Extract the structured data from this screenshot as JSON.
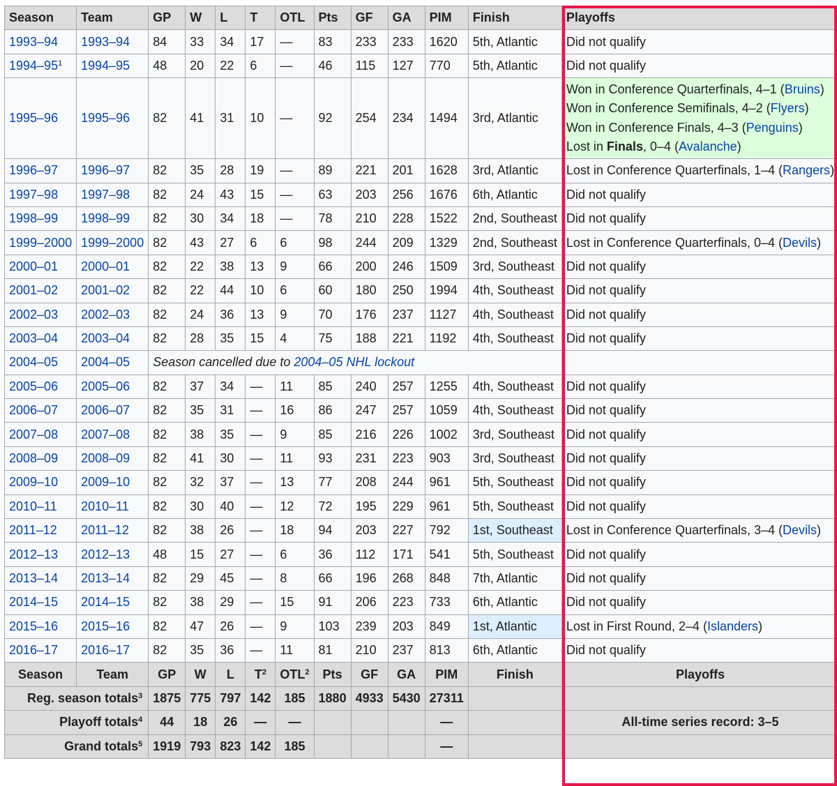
{
  "headers": [
    "Season",
    "Team",
    "GP",
    "W",
    "L",
    "T",
    "OTL",
    "Pts",
    "GF",
    "GA",
    "PIM",
    "Finish",
    "Playoffs"
  ],
  "rows": [
    {
      "season": "1993–94",
      "team": "1993–94",
      "gp": "84",
      "w": "33",
      "l": "34",
      "t": "17",
      "otl": "—",
      "pts": "83",
      "gf": "233",
      "ga": "233",
      "pim": "1620",
      "finish": "5th, Atlantic",
      "playoffs": "Did not qualify"
    },
    {
      "season": "1994–95",
      "season_sup": "1",
      "team": "1994–95",
      "gp": "48",
      "w": "20",
      "l": "22",
      "t": "6",
      "otl": "—",
      "pts": "46",
      "gf": "115",
      "ga": "127",
      "pim": "770",
      "finish": "5th, Atlantic",
      "playoffs": "Did not qualify"
    },
    {
      "season": "1995–96",
      "team": "1995–96",
      "gp": "82",
      "w": "41",
      "l": "31",
      "t": "10",
      "otl": "—",
      "pts": "92",
      "gf": "254",
      "ga": "234",
      "pim": "1494",
      "finish": "3rd, Atlantic",
      "playoff_lines": [
        {
          "pre": "Won in Conference Quarterfinals, 4–1 (",
          "bold": "",
          "link": "Bruins",
          "post": ")"
        },
        {
          "pre": "Won in Conference Semifinals, 4–2 (",
          "bold": "",
          "link": "Flyers",
          "post": ")"
        },
        {
          "pre": "Won in Conference Finals, 4–3 (",
          "bold": "",
          "link": "Penguins",
          "post": ")"
        },
        {
          "pre": "Lost in ",
          "bold": "Finals",
          "mid": ", 0–4 (",
          "link": "Avalanche",
          "post": ")"
        }
      ]
    },
    {
      "season": "1996–97",
      "team": "1996–97",
      "gp": "82",
      "w": "35",
      "l": "28",
      "t": "19",
      "otl": "—",
      "pts": "89",
      "gf": "221",
      "ga": "201",
      "pim": "1628",
      "finish": "3rd, Atlantic",
      "playoff_pre": "Lost in Conference Quarterfinals, 1–4 (",
      "playoff_link": "Rangers",
      "playoff_post": ")"
    },
    {
      "season": "1997–98",
      "team": "1997–98",
      "gp": "82",
      "w": "24",
      "l": "43",
      "t": "15",
      "otl": "—",
      "pts": "63",
      "gf": "203",
      "ga": "256",
      "pim": "1676",
      "finish": "6th, Atlantic",
      "playoffs": "Did not qualify"
    },
    {
      "season": "1998–99",
      "team": "1998–99",
      "gp": "82",
      "w": "30",
      "l": "34",
      "t": "18",
      "otl": "—",
      "pts": "78",
      "gf": "210",
      "ga": "228",
      "pim": "1522",
      "finish": "2nd, Southeast",
      "playoffs": "Did not qualify"
    },
    {
      "season": "1999–2000",
      "team": "1999–2000",
      "gp": "82",
      "w": "43",
      "l": "27",
      "t": "6",
      "otl": "6",
      "pts": "98",
      "gf": "244",
      "ga": "209",
      "pim": "1329",
      "finish": "2nd, Southeast",
      "playoff_pre": "Lost in Conference Quarterfinals, 0–4 (",
      "playoff_link": "Devils",
      "playoff_post": ")"
    },
    {
      "season": "2000–01",
      "team": "2000–01",
      "gp": "82",
      "w": "22",
      "l": "38",
      "t": "13",
      "otl": "9",
      "pts": "66",
      "gf": "200",
      "ga": "246",
      "pim": "1509",
      "finish": "3rd, Southeast",
      "playoffs": "Did not qualify"
    },
    {
      "season": "2001–02",
      "team": "2001–02",
      "gp": "82",
      "w": "22",
      "l": "44",
      "t": "10",
      "otl": "6",
      "pts": "60",
      "gf": "180",
      "ga": "250",
      "pim": "1994",
      "finish": "4th, Southeast",
      "playoffs": "Did not qualify"
    },
    {
      "season": "2002–03",
      "team": "2002–03",
      "gp": "82",
      "w": "24",
      "l": "36",
      "t": "13",
      "otl": "9",
      "pts": "70",
      "gf": "176",
      "ga": "237",
      "pim": "1127",
      "finish": "4th, Southeast",
      "playoffs": "Did not qualify"
    },
    {
      "season": "2003–04",
      "team": "2003–04",
      "gp": "82",
      "w": "28",
      "l": "35",
      "t": "15",
      "otl": "4",
      "pts": "75",
      "gf": "188",
      "ga": "221",
      "pim": "1192",
      "finish": "4th, Southeast",
      "playoffs": "Did not qualify"
    },
    {
      "season": "2004–05",
      "team": "2004–05",
      "cancelled_pre": "Season cancelled due to ",
      "cancelled_link": "2004–05 NHL lockout"
    },
    {
      "season": "2005–06",
      "team": "2005–06",
      "gp": "82",
      "w": "37",
      "l": "34",
      "t": "—",
      "otl": "11",
      "pts": "85",
      "gf": "240",
      "ga": "257",
      "pim": "1255",
      "finish": "4th, Southeast",
      "playoffs": "Did not qualify"
    },
    {
      "season": "2006–07",
      "team": "2006–07",
      "gp": "82",
      "w": "35",
      "l": "31",
      "t": "—",
      "otl": "16",
      "pts": "86",
      "gf": "247",
      "ga": "257",
      "pim": "1059",
      "finish": "4th, Southeast",
      "playoffs": "Did not qualify"
    },
    {
      "season": "2007–08",
      "team": "2007–08",
      "gp": "82",
      "w": "38",
      "l": "35",
      "t": "—",
      "otl": "9",
      "pts": "85",
      "gf": "216",
      "ga": "226",
      "pim": "1002",
      "finish": "3rd, Southeast",
      "playoffs": "Did not qualify"
    },
    {
      "season": "2008–09",
      "team": "2008–09",
      "gp": "82",
      "w": "41",
      "l": "30",
      "t": "—",
      "otl": "11",
      "pts": "93",
      "gf": "231",
      "ga": "223",
      "pim": "903",
      "finish": "3rd, Southeast",
      "playoffs": "Did not qualify"
    },
    {
      "season": "2009–10",
      "team": "2009–10",
      "gp": "82",
      "w": "32",
      "l": "37",
      "t": "—",
      "otl": "13",
      "pts": "77",
      "gf": "208",
      "ga": "244",
      "pim": "961",
      "finish": "5th, Southeast",
      "playoffs": "Did not qualify"
    },
    {
      "season": "2010–11",
      "team": "2010–11",
      "gp": "82",
      "w": "30",
      "l": "40",
      "t": "—",
      "otl": "12",
      "pts": "72",
      "gf": "195",
      "ga": "229",
      "pim": "961",
      "finish": "5th, Southeast",
      "playoffs": "Did not qualify"
    },
    {
      "season": "2011–12",
      "team": "2011–12",
      "gp": "82",
      "w": "38",
      "l": "26",
      "t": "—",
      "otl": "18",
      "pts": "94",
      "gf": "203",
      "ga": "227",
      "pim": "792",
      "finish": "1st, Southeast",
      "finish_first": true,
      "playoff_pre": "Lost in Conference Quarterfinals, 3–4 (",
      "playoff_link": "Devils",
      "playoff_post": ")"
    },
    {
      "season": "2012–13",
      "team": "2012–13",
      "gp": "48",
      "w": "15",
      "l": "27",
      "t": "—",
      "otl": "6",
      "pts": "36",
      "gf": "112",
      "ga": "171",
      "pim": "541",
      "finish": "5th, Southeast",
      "playoffs": "Did not qualify"
    },
    {
      "season": "2013–14",
      "team": "2013–14",
      "gp": "82",
      "w": "29",
      "l": "45",
      "t": "—",
      "otl": "8",
      "pts": "66",
      "gf": "196",
      "ga": "268",
      "pim": "848",
      "finish": "7th, Atlantic",
      "playoffs": "Did not qualify"
    },
    {
      "season": "2014–15",
      "team": "2014–15",
      "gp": "82",
      "w": "38",
      "l": "29",
      "t": "—",
      "otl": "15",
      "pts": "91",
      "gf": "206",
      "ga": "223",
      "pim": "733",
      "finish": "6th, Atlantic",
      "playoffs": "Did not qualify"
    },
    {
      "season": "2015–16",
      "team": "2015–16",
      "gp": "82",
      "w": "47",
      "l": "26",
      "t": "—",
      "otl": "9",
      "pts": "103",
      "gf": "239",
      "ga": "203",
      "pim": "849",
      "finish": "1st, Atlantic",
      "finish_first": true,
      "playoff_pre": "Lost in First Round, 2–4 (",
      "playoff_link": "Islanders",
      "playoff_post": ")"
    },
    {
      "season": "2016–17",
      "team": "2016–17",
      "gp": "82",
      "w": "35",
      "l": "36",
      "t": "—",
      "otl": "11",
      "pts": "81",
      "gf": "210",
      "ga": "237",
      "pim": "813",
      "finish": "6th, Atlantic",
      "playoffs": "Did not qualify"
    }
  ],
  "footer_headers": [
    "Season",
    "Team",
    "GP",
    "W",
    "L",
    "T",
    "OTL",
    "Pts",
    "GF",
    "GA",
    "PIM",
    "Finish",
    "Playoffs"
  ],
  "footer_sup": {
    "T": "2",
    "OTL": "2"
  },
  "totals": [
    {
      "label": "Reg. season totals",
      "sup": "3",
      "gp": "1875",
      "w": "775",
      "l": "797",
      "t": "142",
      "otl": "185",
      "pts": "1880",
      "gf": "4933",
      "ga": "5430",
      "pim": "27311",
      "finish": "",
      "playoffs": ""
    },
    {
      "label": "Playoff totals",
      "sup": "4",
      "gp": "44",
      "w": "18",
      "l": "26",
      "t": "—",
      "otl": "—",
      "pts": "",
      "gf": "",
      "ga": "",
      "pim": "—",
      "finish": "",
      "playoffs": "All-time series record: 3–5"
    },
    {
      "label": "Grand totals",
      "sup": "5",
      "gp": "1919",
      "w": "793",
      "l": "823",
      "t": "142",
      "otl": "185",
      "pts": "",
      "gf": "",
      "ga": "",
      "pim": "—",
      "finish": "",
      "playoffs": ""
    }
  ],
  "colors": {
    "link": "#0645ad",
    "won_bg": "#ddffdd",
    "first_bg": "#ddeeff",
    "highlight": "#e8174b",
    "header_bg": "#dcdcdc"
  }
}
